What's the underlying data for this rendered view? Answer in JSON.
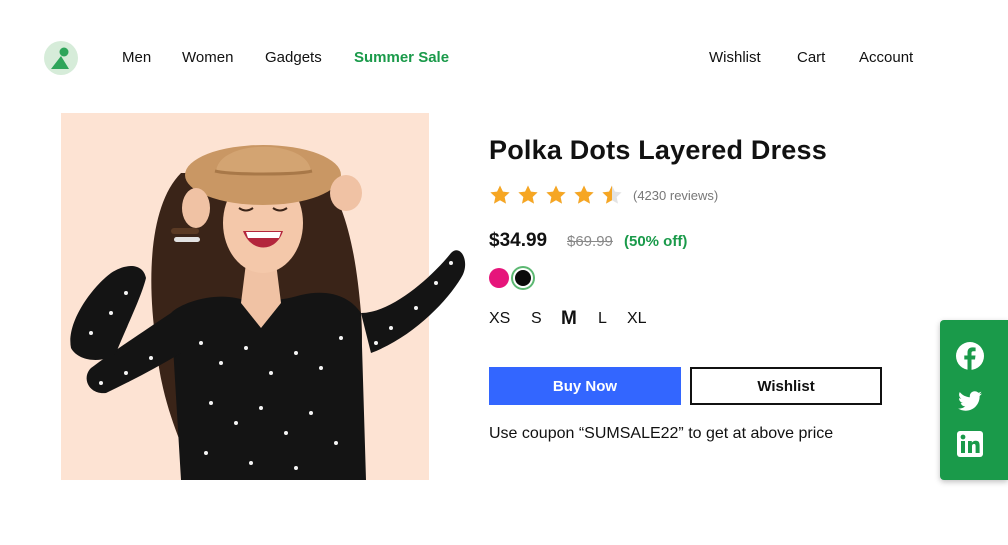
{
  "header": {
    "logo_icon": "brand-logo-icon",
    "nav_left": [
      "Men",
      "Women",
      "Gadgets"
    ],
    "nav_sale": "Summer Sale",
    "nav_right": [
      "Wishlist",
      "Cart",
      "Account"
    ]
  },
  "product": {
    "title": "Polka Dots Layered Dress",
    "rating": 4.5,
    "rating_max": 5,
    "reviews": "(4230 reviews)",
    "price": "$34.99",
    "mrp": "$69.99",
    "discount": "(50% off)",
    "colors": [
      "#e6157b",
      "#0b0b0b"
    ],
    "selected_color": "#0b0b0b",
    "sizes": [
      "XS",
      "S",
      "M",
      "L",
      "XL"
    ],
    "selected_size": "M",
    "buy_label": "Buy Now",
    "wishlist_label": "Wishlist",
    "coupon_text": "Use coupon “SUMSALE22” to get at above price"
  },
  "social": {
    "icons": [
      "facebook-icon",
      "twitter-icon",
      "linkedin-icon"
    ],
    "color": "#1a9a4a"
  },
  "theme": {
    "accent": "#1a9a4a",
    "primary_button": "#3366ff",
    "star_color": "#f6a623",
    "image_bg": "#fde3d3"
  }
}
